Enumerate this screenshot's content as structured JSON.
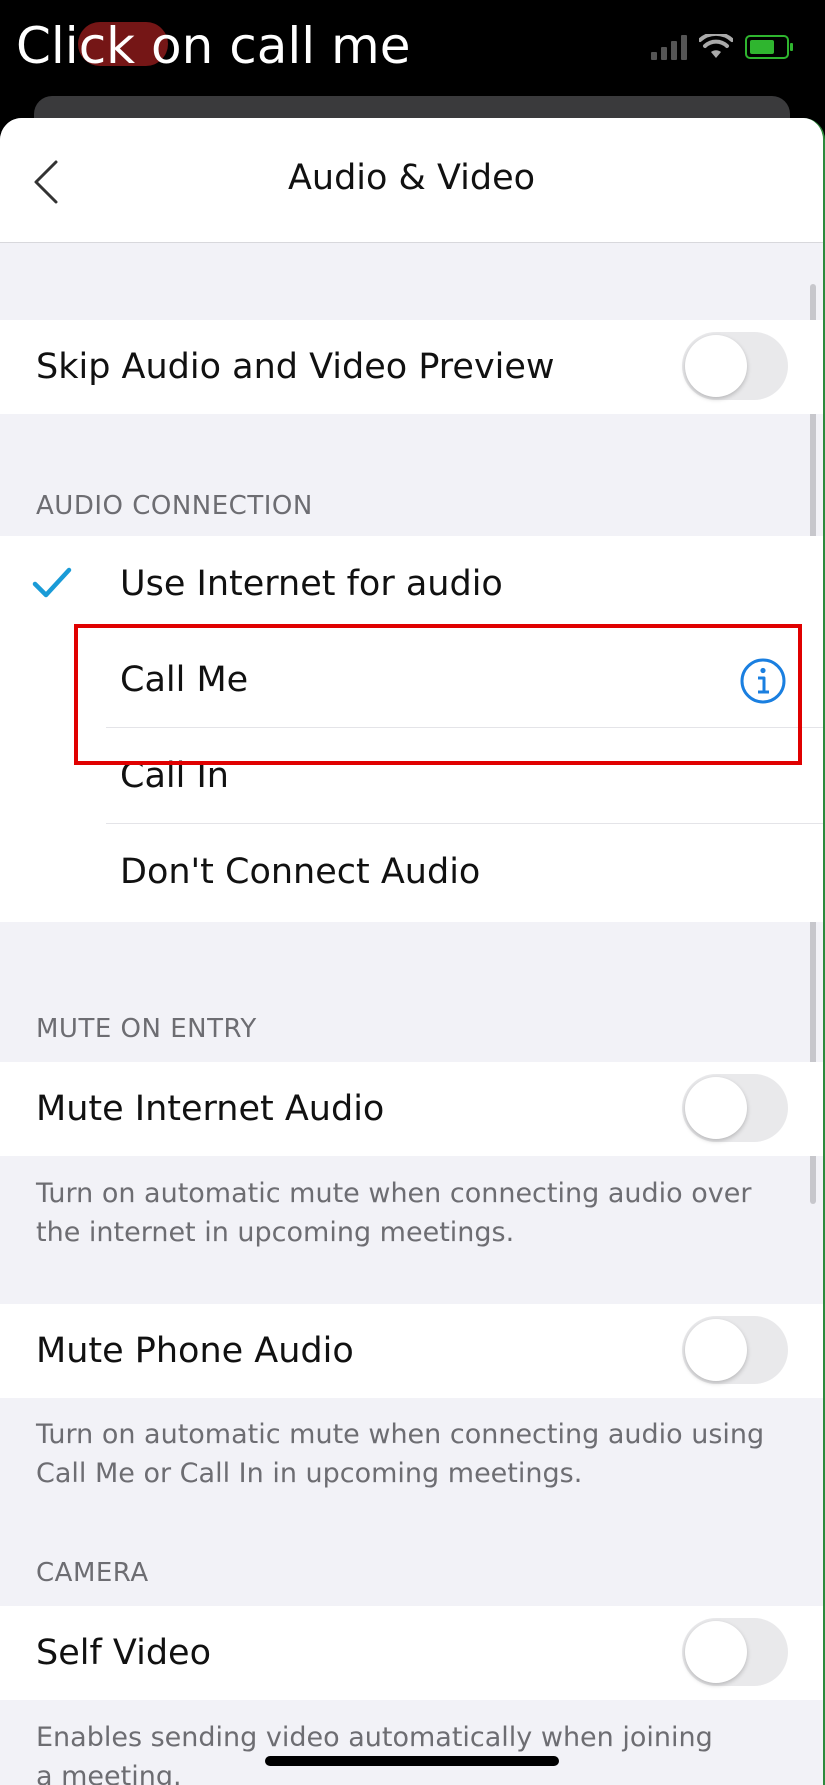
{
  "caption": "Click on call me",
  "nav": {
    "title": "Audio & Video"
  },
  "skip_preview": {
    "label": "Skip Audio and Video Preview",
    "enabled": false
  },
  "audio_connection": {
    "header": "AUDIO CONNECTION",
    "options": [
      {
        "label": "Use Internet for audio",
        "selected": true
      },
      {
        "label": "Call Me",
        "selected": false
      },
      {
        "label": "Call In",
        "selected": false
      },
      {
        "label": "Don't Connect Audio",
        "selected": false
      }
    ]
  },
  "mute_on_entry": {
    "header": "MUTE ON ENTRY",
    "internet": {
      "label": "Mute Internet Audio",
      "enabled": false,
      "footer": "Turn on automatic mute when connecting audio over the internet in upcoming meetings."
    },
    "phone": {
      "label": "Mute Phone Audio",
      "enabled": false,
      "footer": "Turn on automatic mute when connecting audio using Call Me or Call In in upcoming meetings."
    }
  },
  "camera": {
    "header": "CAMERA",
    "self_video": {
      "label": "Self Video",
      "enabled": false,
      "footer": "Enables sending video automatically when joining a meeting."
    }
  },
  "colors": {
    "accent": "#1a9bd7",
    "info": "#1a7fe0",
    "highlight": "#e00000"
  },
  "icons": [
    "back-chevron-icon",
    "checkmark-icon",
    "info-icon",
    "wifi-icon",
    "signal-icon",
    "battery-charging-icon"
  ]
}
